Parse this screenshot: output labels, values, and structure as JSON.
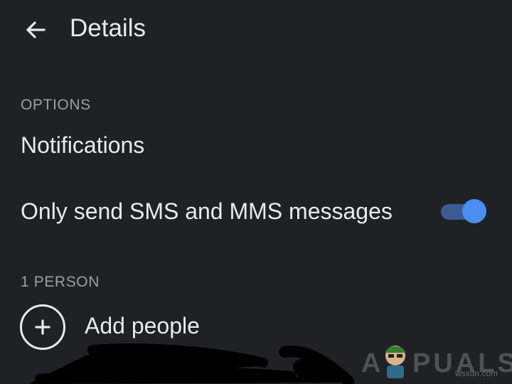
{
  "header": {
    "title": "Details",
    "back_icon": "arrow-back-icon"
  },
  "options_section": {
    "header": "OPTIONS",
    "items": [
      {
        "label": "Notifications"
      },
      {
        "label": "Only send SMS and MMS messages",
        "toggle_on": true
      }
    ]
  },
  "people_section": {
    "header": "1 PERSON",
    "add_label": "Add people",
    "add_icon": "plus-circle-icon"
  },
  "watermark": {
    "logo_text": "APPUALS",
    "site": "wsxdn.com"
  },
  "colors": {
    "background": "#202124",
    "text": "#e8eaed",
    "section_header": "#9aa0a6",
    "toggle_thumb": "#4a8ff0",
    "toggle_track": "#3d5a95"
  }
}
